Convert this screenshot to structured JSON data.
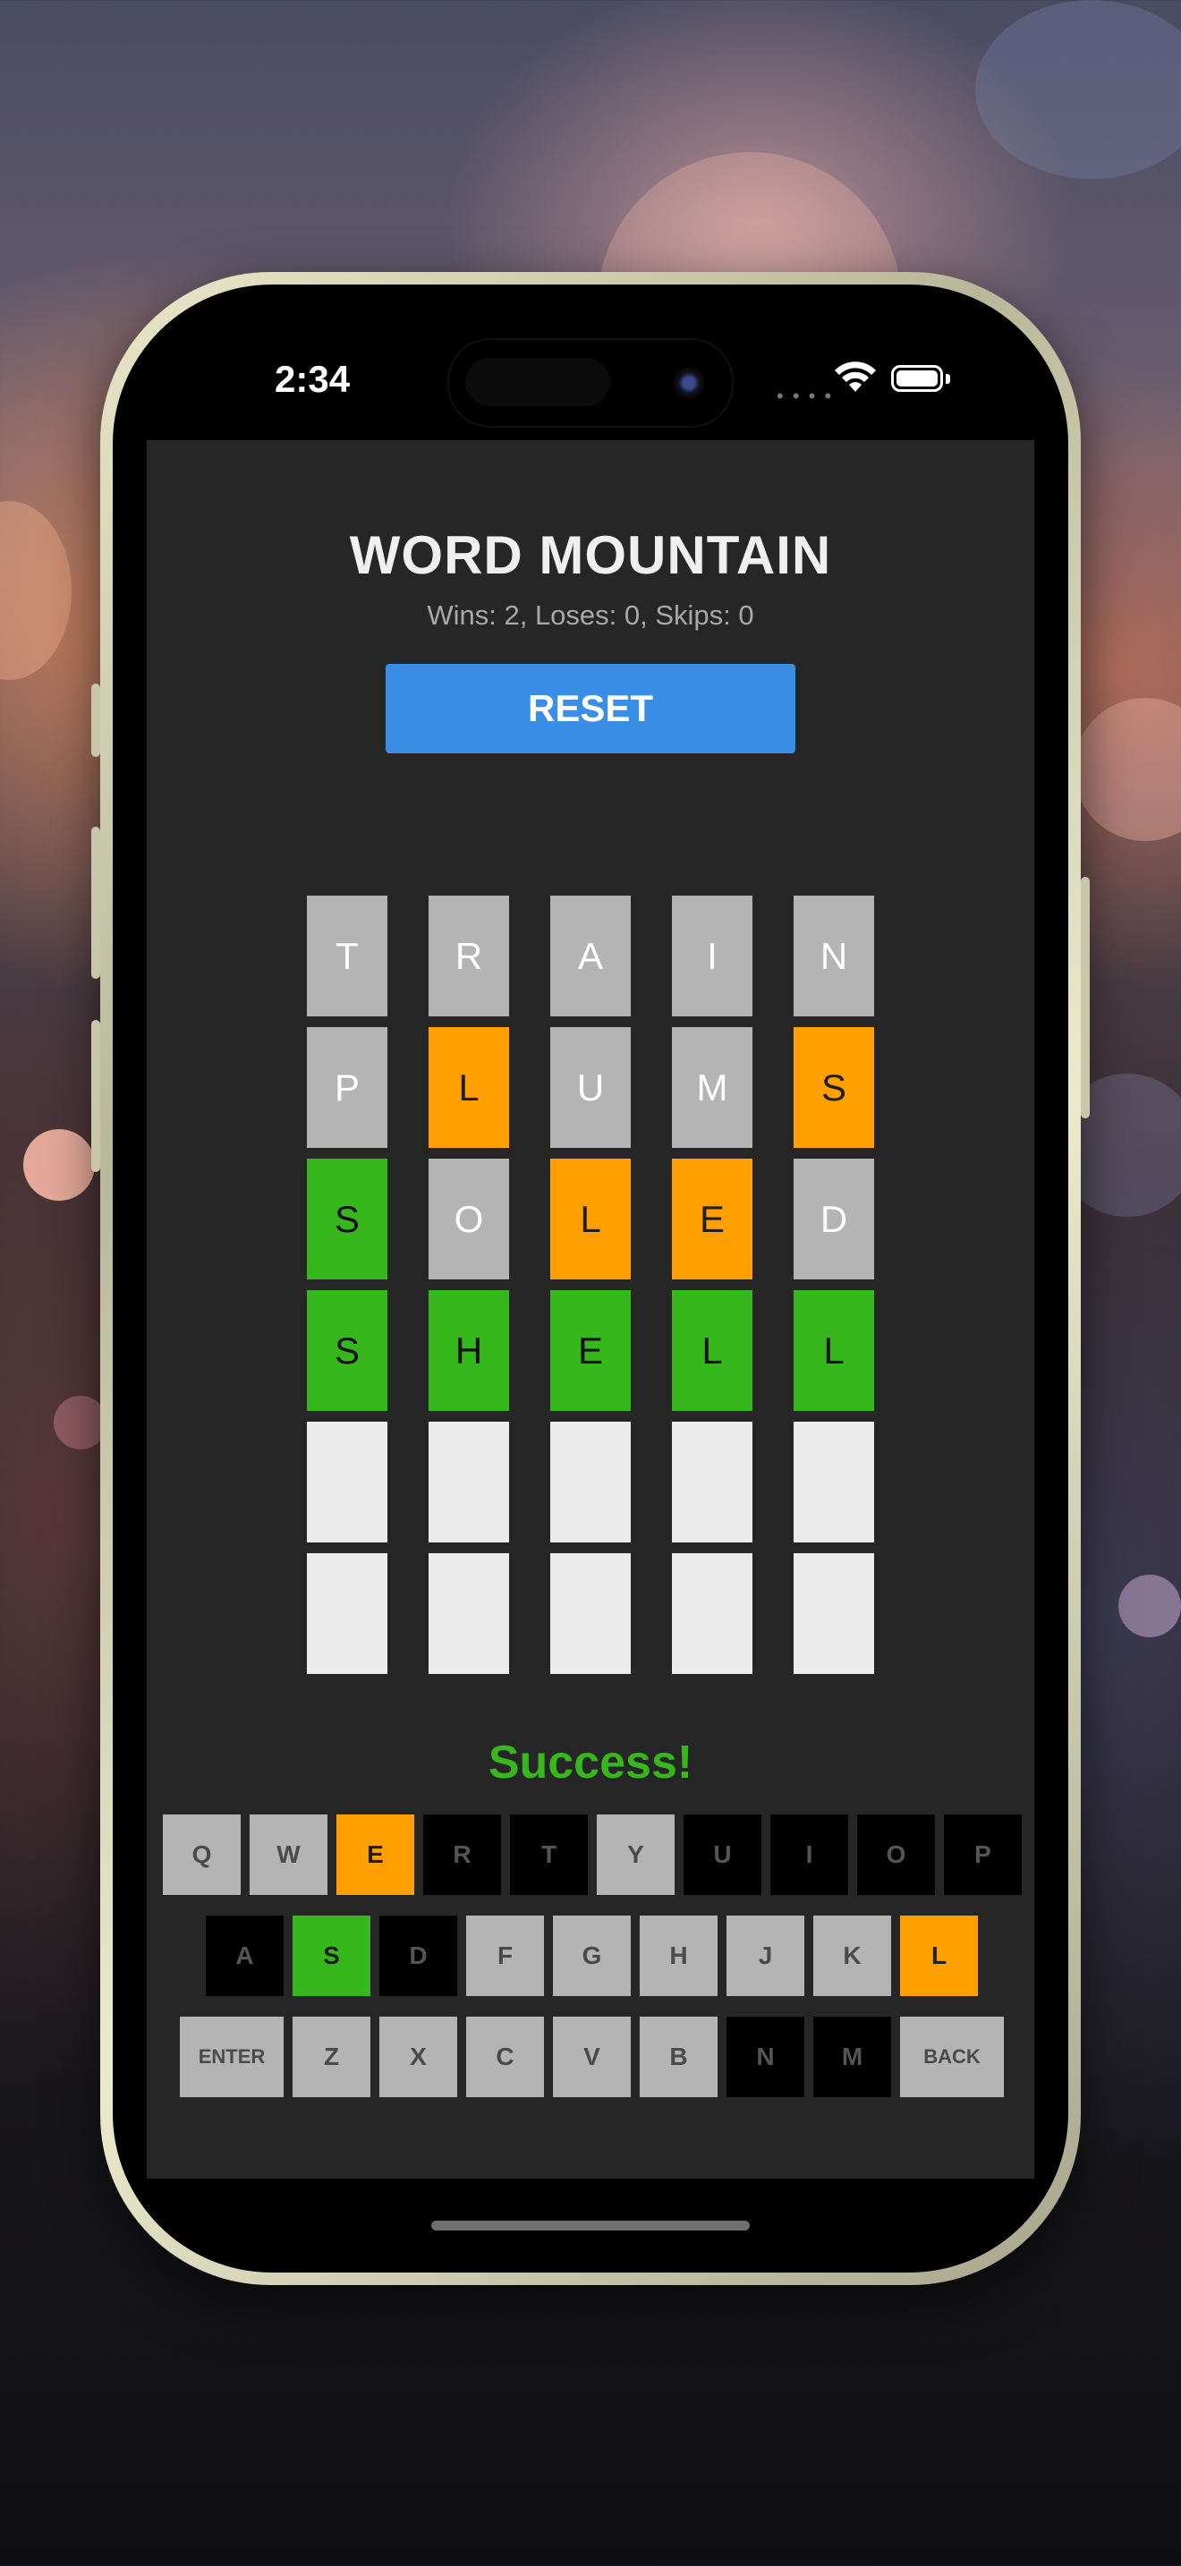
{
  "status_bar": {
    "time": "2:34"
  },
  "game": {
    "title": "WORD MOUNTAIN",
    "stats": "Wins: 2, Loses: 0, Skips: 0",
    "reset_label": "RESET",
    "message": "Success!"
  },
  "board": {
    "rows": [
      [
        {
          "letter": "T",
          "state": "gray"
        },
        {
          "letter": "R",
          "state": "gray"
        },
        {
          "letter": "A",
          "state": "gray"
        },
        {
          "letter": "I",
          "state": "gray"
        },
        {
          "letter": "N",
          "state": "gray"
        }
      ],
      [
        {
          "letter": "P",
          "state": "gray"
        },
        {
          "letter": "L",
          "state": "orange"
        },
        {
          "letter": "U",
          "state": "gray"
        },
        {
          "letter": "M",
          "state": "gray"
        },
        {
          "letter": "S",
          "state": "orange"
        }
      ],
      [
        {
          "letter": "S",
          "state": "green"
        },
        {
          "letter": "O",
          "state": "gray"
        },
        {
          "letter": "L",
          "state": "orange"
        },
        {
          "letter": "E",
          "state": "orange"
        },
        {
          "letter": "D",
          "state": "gray"
        }
      ],
      [
        {
          "letter": "S",
          "state": "green"
        },
        {
          "letter": "H",
          "state": "green"
        },
        {
          "letter": "E",
          "state": "green"
        },
        {
          "letter": "L",
          "state": "green"
        },
        {
          "letter": "L",
          "state": "green"
        }
      ],
      [
        {
          "letter": "",
          "state": "empty"
        },
        {
          "letter": "",
          "state": "empty"
        },
        {
          "letter": "",
          "state": "empty"
        },
        {
          "letter": "",
          "state": "empty"
        },
        {
          "letter": "",
          "state": "empty"
        }
      ],
      [
        {
          "letter": "",
          "state": "empty"
        },
        {
          "letter": "",
          "state": "empty"
        },
        {
          "letter": "",
          "state": "empty"
        },
        {
          "letter": "",
          "state": "empty"
        },
        {
          "letter": "",
          "state": "empty"
        }
      ]
    ]
  },
  "keyboard": {
    "row1": [
      {
        "label": "Q",
        "state": "gray"
      },
      {
        "label": "W",
        "state": "gray"
      },
      {
        "label": "E",
        "state": "orange"
      },
      {
        "label": "R",
        "state": "black"
      },
      {
        "label": "T",
        "state": "black"
      },
      {
        "label": "Y",
        "state": "gray"
      },
      {
        "label": "U",
        "state": "black"
      },
      {
        "label": "I",
        "state": "black"
      },
      {
        "label": "O",
        "state": "black"
      },
      {
        "label": "P",
        "state": "black"
      }
    ],
    "row2": [
      {
        "label": "A",
        "state": "black"
      },
      {
        "label": "S",
        "state": "green"
      },
      {
        "label": "D",
        "state": "black"
      },
      {
        "label": "F",
        "state": "gray"
      },
      {
        "label": "G",
        "state": "gray"
      },
      {
        "label": "H",
        "state": "gray"
      },
      {
        "label": "J",
        "state": "gray"
      },
      {
        "label": "K",
        "state": "gray"
      },
      {
        "label": "L",
        "state": "orange"
      }
    ],
    "row3": [
      {
        "label": "ENTER",
        "state": "gray",
        "wide": true
      },
      {
        "label": "Z",
        "state": "gray"
      },
      {
        "label": "X",
        "state": "gray"
      },
      {
        "label": "C",
        "state": "gray"
      },
      {
        "label": "V",
        "state": "gray"
      },
      {
        "label": "B",
        "state": "gray"
      },
      {
        "label": "N",
        "state": "black"
      },
      {
        "label": "M",
        "state": "black"
      },
      {
        "label": "BACK",
        "state": "gray",
        "wide": true
      }
    ]
  },
  "colors": {
    "gray": "#b4b4b4",
    "orange": "#ff9f00",
    "green": "#36b71c",
    "accent_blue": "#3a8ee6",
    "background": "#262626"
  },
  "icons": [
    "wifi-icon",
    "battery-icon",
    "camera-icon"
  ]
}
